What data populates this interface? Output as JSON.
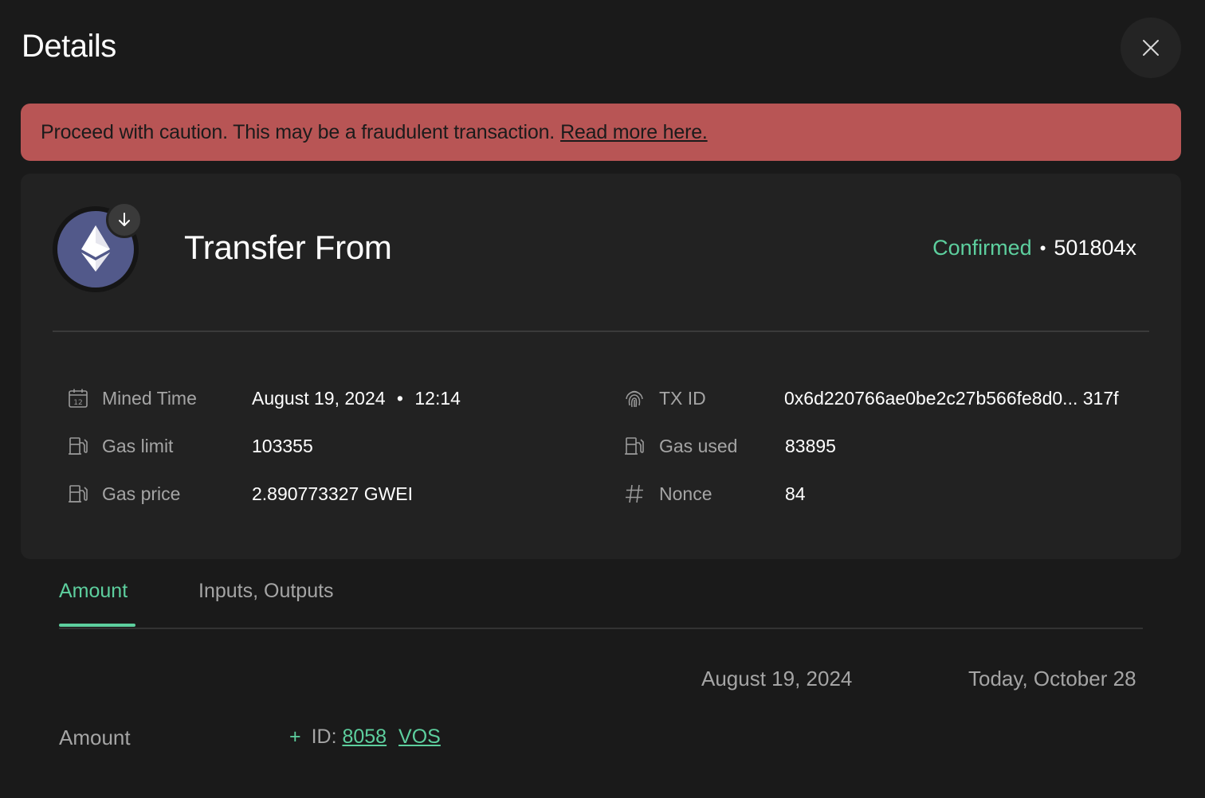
{
  "header": {
    "title": "Details",
    "close_icon": "close-icon"
  },
  "warning": {
    "message": "Proceed with caution. This may be a fraudulent transaction.",
    "link_label": "Read more here.",
    "color": "#b85555"
  },
  "transaction": {
    "asset_icon": "ethereum-icon",
    "direction_icon": "arrow-down-icon",
    "title": "Transfer From",
    "status": "Confirmed",
    "separator": "•",
    "confirmations": "501804x",
    "status_color": "#5dcf9e"
  },
  "details": {
    "mined_time": {
      "icon": "calendar-icon",
      "label": "Mined Time",
      "date": "August 19, 2024",
      "separator": "•",
      "time": "12:14"
    },
    "gas_limit": {
      "icon": "gas-pump-icon",
      "label": "Gas limit",
      "value": "103355"
    },
    "gas_price": {
      "icon": "gas-pump-icon",
      "label": "Gas price",
      "value": "2.890773327 GWEI"
    },
    "tx_id": {
      "icon": "fingerprint-icon",
      "label": "TX ID",
      "value": "0x6d220766ae0be2c27b566fe8d0... 317f"
    },
    "gas_used": {
      "icon": "gas-pump-icon",
      "label": "Gas used",
      "value": "83895"
    },
    "nonce": {
      "icon": "hash-icon",
      "label": "Nonce",
      "value": "84"
    }
  },
  "tabs": [
    {
      "label": "Amount",
      "active": true
    },
    {
      "label": "Inputs, Outputs",
      "active": false
    }
  ],
  "amount_table": {
    "columns": [
      "August 19, 2024",
      "Today, October 28"
    ],
    "row_label": "Amount",
    "plus": "+",
    "id_prefix": "ID:",
    "id_value": "8058",
    "token": "VOS"
  }
}
